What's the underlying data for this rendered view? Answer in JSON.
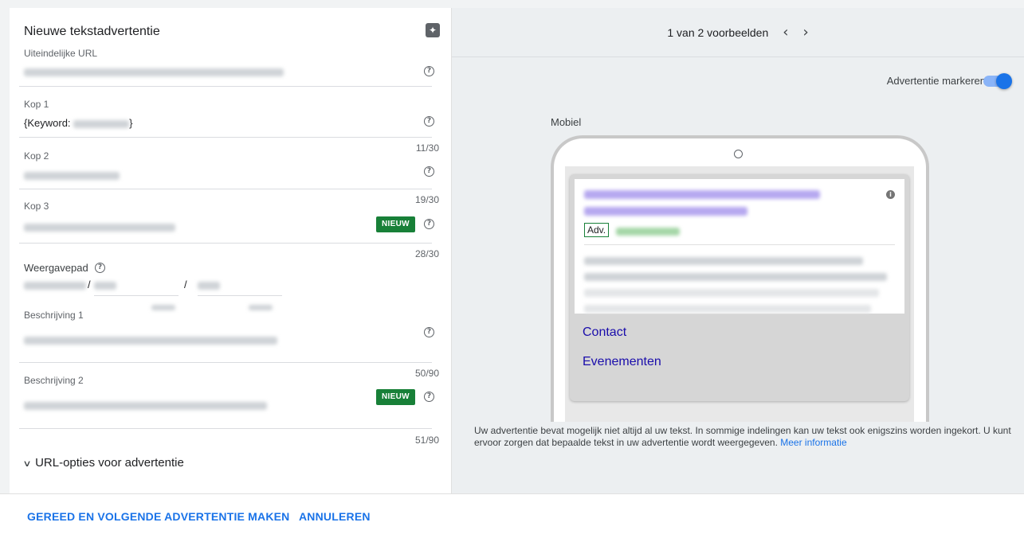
{
  "editor": {
    "title": "Nieuwe tekstadvertentie",
    "final_url_label": "Uiteindelijke URL",
    "headline1_label": "Kop 1",
    "headline1_prefix": "{Keyword:",
    "headline1_suffix": "}",
    "headline2_label": "Kop 2",
    "headline2_counter": "11/30",
    "headline3_label": "Kop 3",
    "headline3_counter": "19/30",
    "headline3_badge": "NIEUW",
    "display_path_label": "Weergavepad",
    "display_path_counter": "28/30",
    "path_separator": "/",
    "description1_label": "Beschrijving 1",
    "description2_label": "Beschrijving 2",
    "description2_counter": "50/90",
    "description2_badge": "NIEUW",
    "description_final_counter": "51/90",
    "url_options_label": "URL-opties voor advertentie",
    "help_glyph": "?",
    "sparkle_glyph": "✦"
  },
  "preview": {
    "pager_text": "1 van 2 voorbeelden",
    "prev_glyph": "‹",
    "next_glyph": "›",
    "highlight_label": "Advertentie markeren",
    "highlight_enabled": true,
    "device_label": "Mobiel",
    "ad_badge": "Adv.",
    "info_glyph": "i",
    "sitelinks": [
      "Contact",
      "Evenementen"
    ],
    "disclaimer": "Uw advertentie bevat mogelijk niet altijd al uw tekst. In sommige indelingen kan uw tekst ook enigszins worden ingekort. U kunt ervoor zorgen dat bepaalde tekst in uw advertentie wordt weergegeven.",
    "more_info_link": "Meer informatie"
  },
  "footer": {
    "done_button": "GEREED EN VOLGENDE ADVERTENTIE MAKEN",
    "cancel_button": "ANNULEREN"
  },
  "colors": {
    "accent": "#1a73e8",
    "badge": "#188038",
    "sitelink": "#1a0dab"
  }
}
